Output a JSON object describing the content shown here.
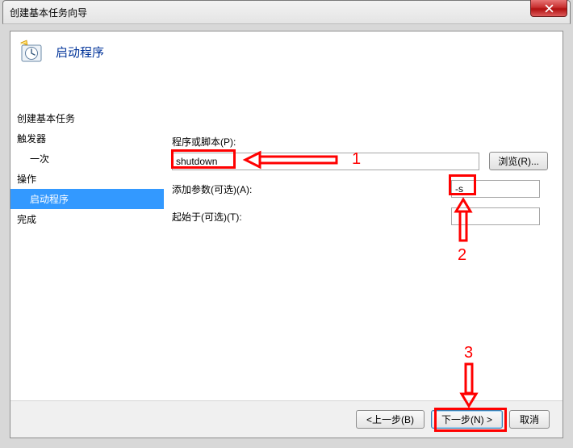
{
  "window": {
    "title": "创建基本任务向导"
  },
  "header": {
    "page_title": "启动程序"
  },
  "sidebar": {
    "create_task": "创建基本任务",
    "trigger": "触发器",
    "trigger_sub": "一次",
    "action": "操作",
    "action_sub": "启动程序",
    "finish": "完成"
  },
  "form": {
    "program_label": "程序或脚本(P):",
    "program_value": "shutdown",
    "browse_label": "浏览(R)...",
    "args_label": "添加参数(可选)(A):",
    "args_value": "-s",
    "startin_label": "起始于(可选)(T):",
    "startin_value": ""
  },
  "buttons": {
    "back": "<上一步(B)",
    "next": "下一步(N) >",
    "cancel": "取消"
  },
  "annotations": {
    "n1": "1",
    "n2": "2",
    "n3": "3"
  }
}
